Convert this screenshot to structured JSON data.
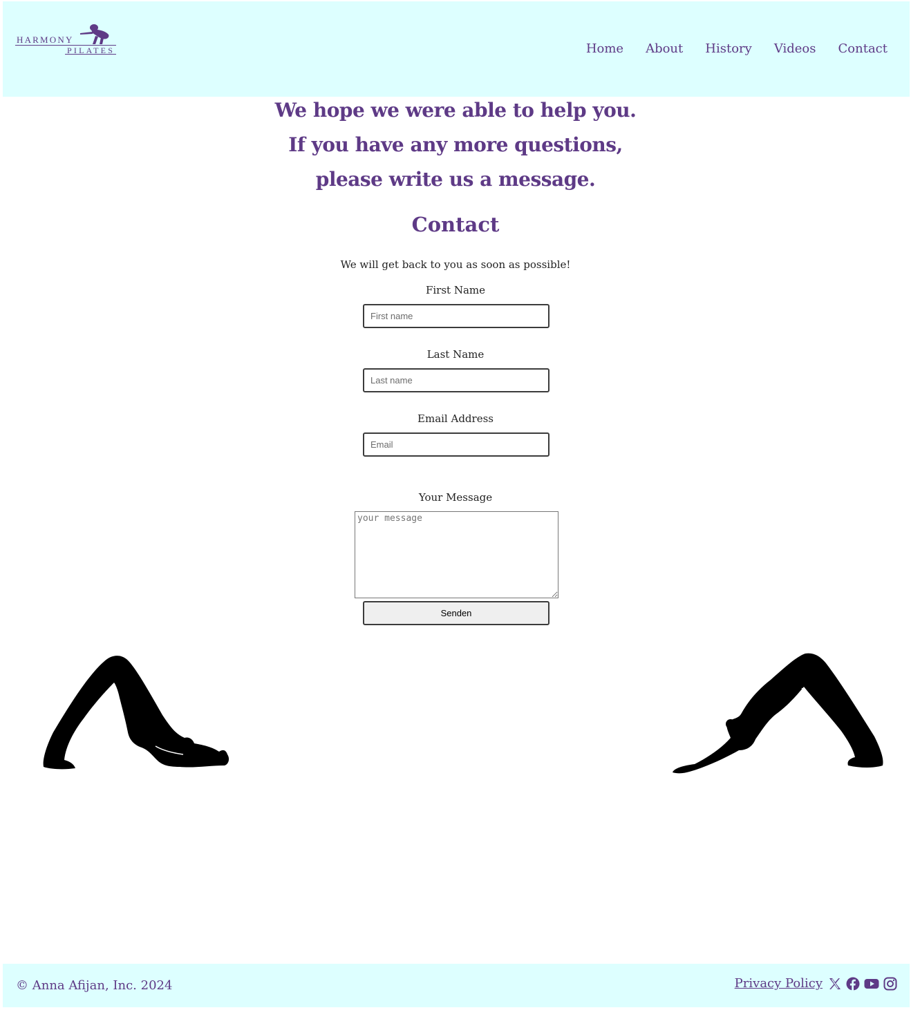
{
  "brand": {
    "logo_line1": "HARMONY",
    "logo_line2": "PILATES",
    "accent_color": "#5e3a86",
    "header_bg": "#ddffff"
  },
  "nav": {
    "items": [
      {
        "label": "Home"
      },
      {
        "label": "About"
      },
      {
        "label": "History"
      },
      {
        "label": "Videos"
      },
      {
        "label": "Contact"
      }
    ]
  },
  "hero": {
    "line1": "We hope we were able to help you.",
    "line2": "If you have any more questions,",
    "line3": "please write us a message."
  },
  "contact": {
    "title": "Contact",
    "subtitle": "We will get back to you as soon as possible!",
    "first_name_label": "First Name",
    "first_name_placeholder": "First name",
    "first_name_value": "",
    "last_name_label": "Last Name",
    "last_name_placeholder": "Last name",
    "last_name_value": "",
    "email_label": "Email Address",
    "email_placeholder": "Email",
    "email_value": "",
    "message_label": "Your Message",
    "message_placeholder": "your message",
    "submit_label": "Senden"
  },
  "footer": {
    "copyright": "© Anna Afijan, Inc. 2024",
    "privacy_label": "Privacy Policy",
    "social_icons": [
      "x-twitter-icon",
      "facebook-icon",
      "youtube-icon",
      "instagram-icon"
    ]
  }
}
